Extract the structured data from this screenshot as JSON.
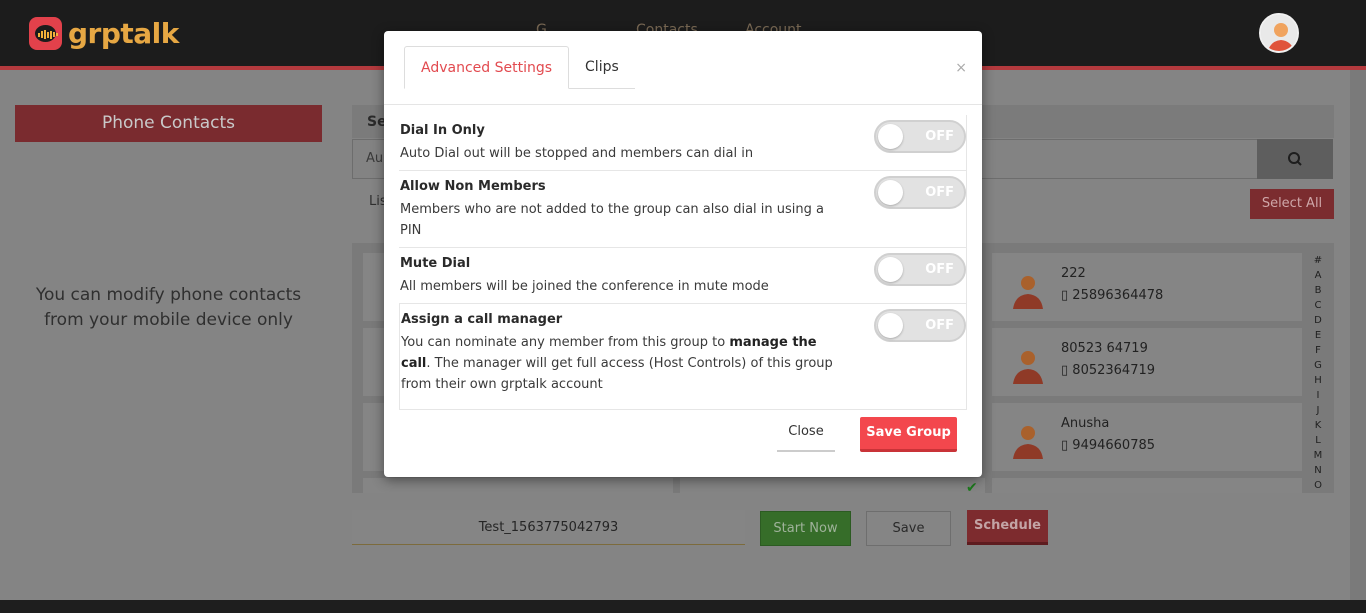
{
  "app": {
    "logo_text": "grptalk",
    "nav_ghost": [
      "G…",
      "Contacts",
      "Account"
    ]
  },
  "background": {
    "phone_contacts_label": "Phone Contacts",
    "modify_note_line1": "You can modify phone contacts",
    "modify_note_line2": "from your mobile device only",
    "search_header": "Se",
    "search_placeholder": "Au",
    "list_tab": "Lis",
    "select_all_label": "Select All",
    "contacts": [
      {
        "name": "222",
        "number": "25896364478"
      },
      {
        "name": "80523 64719",
        "number": "8052364719"
      },
      {
        "name": "Anusha",
        "number": "9494660785"
      }
    ],
    "alphabet": [
      "#",
      "A",
      "B",
      "C",
      "D",
      "E",
      "F",
      "G",
      "H",
      "I",
      "J",
      "K",
      "L",
      "M",
      "N",
      "O"
    ],
    "group_name": "Test_1563775042793",
    "start_now_label": "Start Now",
    "save_label": "Save",
    "schedule_label": "Schedule"
  },
  "modal": {
    "tabs": [
      {
        "label": "Advanced Settings",
        "active": true
      },
      {
        "label": "Clips",
        "active": false
      }
    ],
    "close_x": "×",
    "settings": [
      {
        "title": "Dial In Only",
        "desc": "Auto Dial out will be stopped and members can dial in",
        "state": "OFF"
      },
      {
        "title": "Allow Non Members",
        "desc": "Members who are not added to the group can also dial in using a PIN",
        "state": "OFF"
      },
      {
        "title": "Mute Dial",
        "desc": "All members will be joined the conference in mute mode",
        "state": "OFF"
      },
      {
        "title": "Assign a call manager",
        "desc_pre": "You can nominate any member from this group to ",
        "desc_bold1": "manage the call",
        "desc_post": ". The manager will get full access (Host Controls) of this group from their own grptalk account",
        "state": "OFF"
      }
    ],
    "close_label": "Close",
    "save_group_label": "Save Group"
  },
  "colors": {
    "accent_red": "#f3474d",
    "tab_active": "#e24a4f",
    "logo_orange": "#e6a743"
  }
}
